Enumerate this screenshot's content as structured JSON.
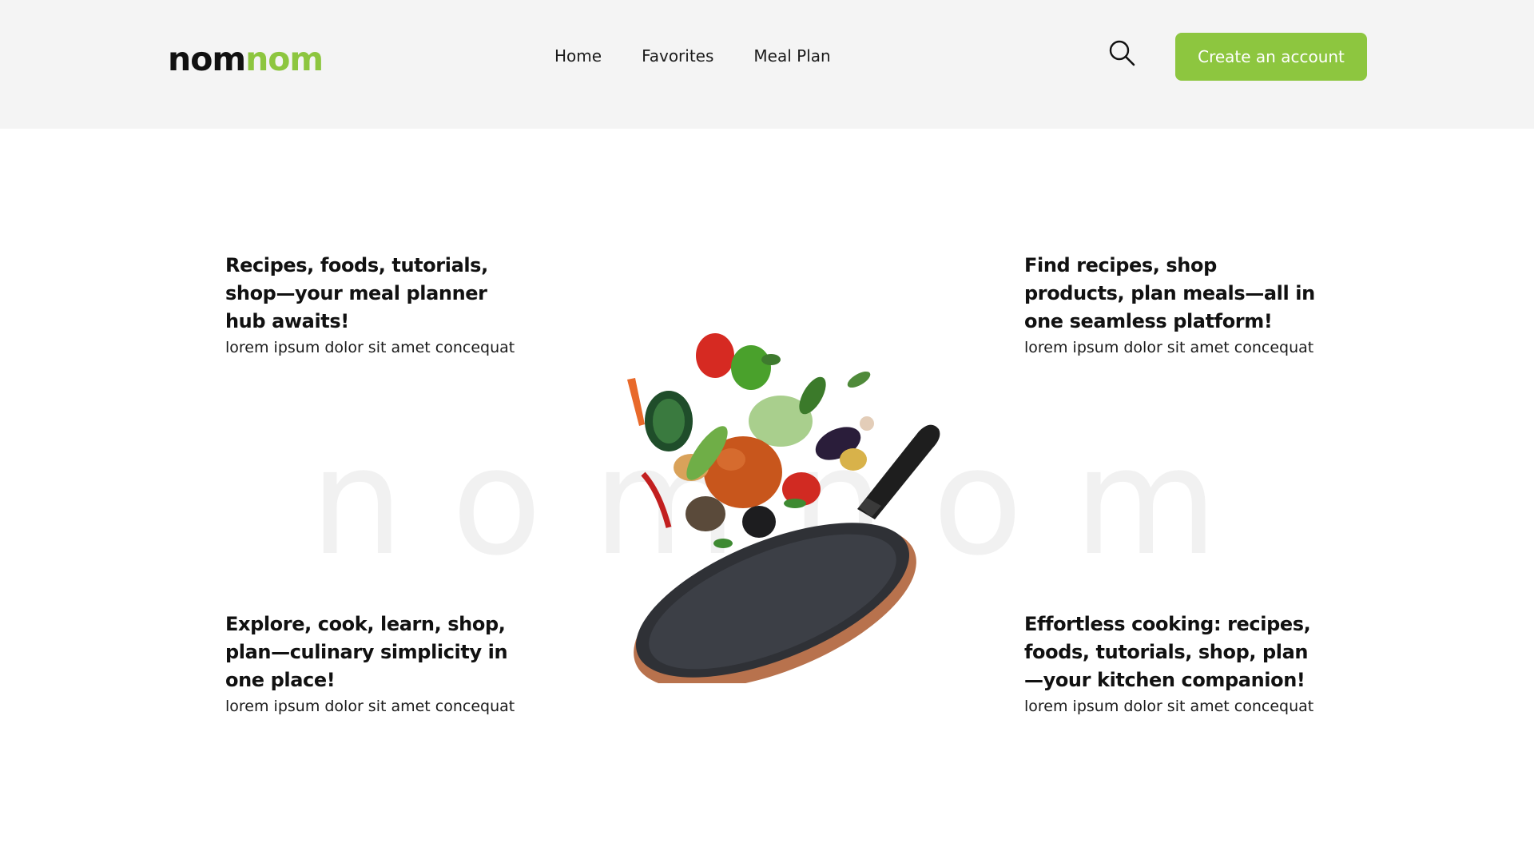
{
  "header": {
    "logo_part1": "nom",
    "logo_part2": "nom",
    "nav": [
      "Home",
      "Favorites",
      "Meal Plan"
    ],
    "search_icon": "search-icon",
    "cta_label": "Create an account"
  },
  "watermark": [
    "n",
    "o",
    "m",
    "n",
    "o",
    "m"
  ],
  "features": [
    {
      "title": "Recipes, foods, tutorials, shop—your meal planner hub awaits!",
      "body": "lorem ipsum dolor sit amet concequat"
    },
    {
      "title": "Find recipes, shop products, plan meals—all in one seamless platform!",
      "body": "lorem ipsum dolor sit amet concequat"
    },
    {
      "title": "Explore, cook, learn, shop, plan—culinary simplicity in one place!",
      "body": "lorem ipsum dolor sit amet concequat"
    },
    {
      "title": "Effortless cooking: recipes, foods, tutorials, shop, plan—your kitchen companion!",
      "body": "lorem ipsum dolor sit amet concequat"
    }
  ],
  "colors": {
    "accent": "#8dc63f",
    "header_bg": "#f4f4f4",
    "text": "#111111",
    "watermark": "#f1f1f1"
  }
}
